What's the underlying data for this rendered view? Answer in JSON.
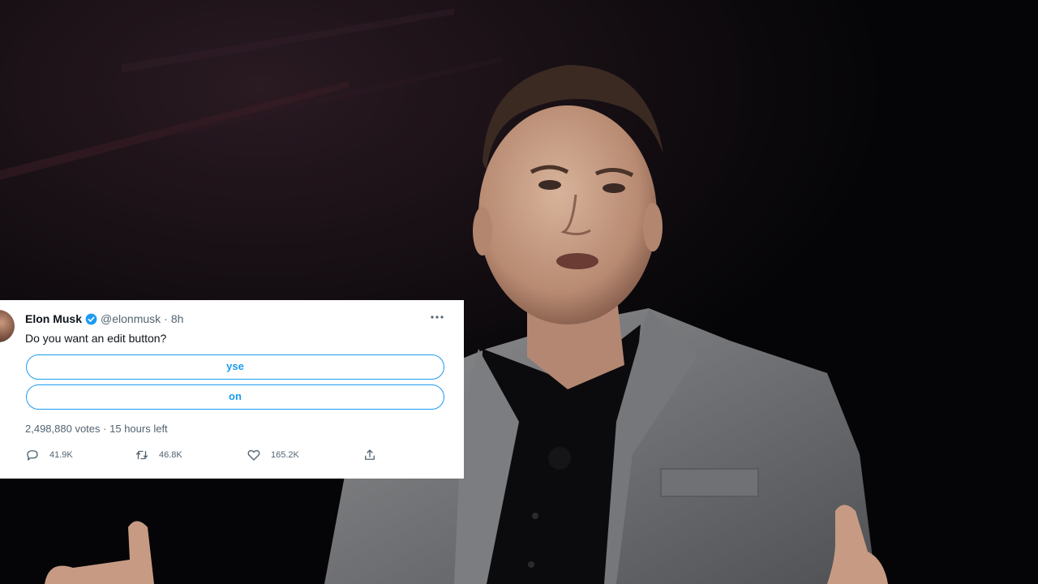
{
  "tweet": {
    "author_name": "Elon Musk",
    "handle": "@elonmusk",
    "separator": "·",
    "time": "8h",
    "text": "Do you want an edit button?",
    "poll": {
      "options": [
        "yse",
        "on"
      ],
      "votes": "2,498,880 votes",
      "meta_separator": "·",
      "time_left": "15 hours left"
    },
    "counts": {
      "replies": "41.9K",
      "retweets": "46.8K",
      "likes": "165.2K"
    },
    "more_icon": "more-horizontal-icon",
    "verified_icon": "verified-badge-icon",
    "accent_color": "#1d9bf0",
    "text_color": "#0f1419",
    "secondary_color": "#536471"
  },
  "background": {
    "icon": "photo-of-speaker-on-stage"
  }
}
